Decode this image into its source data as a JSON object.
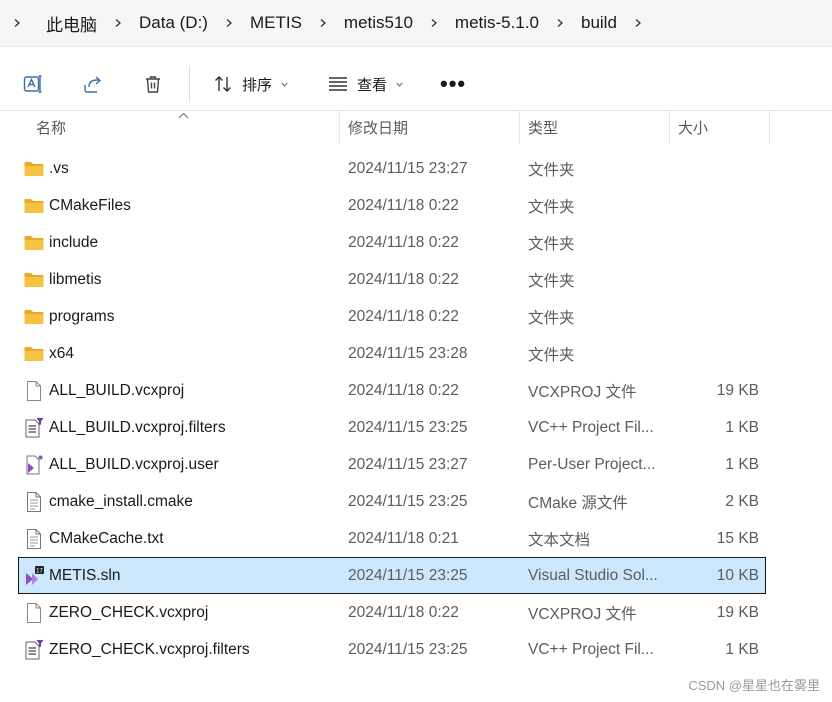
{
  "breadcrumb": {
    "items": [
      "此电脑",
      "Data (D:)",
      "METIS",
      "metis510",
      "metis-5.1.0",
      "build"
    ]
  },
  "toolbar": {
    "rename_icon": "rename-icon",
    "share_icon": "share-icon",
    "delete_icon": "trash-icon",
    "sort_label": "排序",
    "view_label": "查看",
    "more_label": "•••"
  },
  "columns": {
    "name": "名称",
    "modified": "修改日期",
    "type": "类型",
    "size": "大小"
  },
  "files": [
    {
      "name": ".vs",
      "modified": "2024/11/15 23:27",
      "type": "文件夹",
      "size": "",
      "icon": "folder"
    },
    {
      "name": "CMakeFiles",
      "modified": "2024/11/18 0:22",
      "type": "文件夹",
      "size": "",
      "icon": "folder"
    },
    {
      "name": "include",
      "modified": "2024/11/18 0:22",
      "type": "文件夹",
      "size": "",
      "icon": "folder"
    },
    {
      "name": "libmetis",
      "modified": "2024/11/18 0:22",
      "type": "文件夹",
      "size": "",
      "icon": "folder"
    },
    {
      "name": "programs",
      "modified": "2024/11/18 0:22",
      "type": "文件夹",
      "size": "",
      "icon": "folder"
    },
    {
      "name": "x64",
      "modified": "2024/11/15 23:28",
      "type": "文件夹",
      "size": "",
      "icon": "folder"
    },
    {
      "name": "ALL_BUILD.vcxproj",
      "modified": "2024/11/18 0:22",
      "type": "VCXPROJ 文件",
      "size": "19 KB",
      "icon": "file"
    },
    {
      "name": "ALL_BUILD.vcxproj.filters",
      "modified": "2024/11/15 23:25",
      "type": "VC++ Project Fil...",
      "size": "1 KB",
      "icon": "filters"
    },
    {
      "name": "ALL_BUILD.vcxproj.user",
      "modified": "2024/11/15 23:27",
      "type": "Per-User Project...",
      "size": "1 KB",
      "icon": "vs-user"
    },
    {
      "name": "cmake_install.cmake",
      "modified": "2024/11/15 23:25",
      "type": "CMake 源文件",
      "size": "2 KB",
      "icon": "text"
    },
    {
      "name": "CMakeCache.txt",
      "modified": "2024/11/18 0:21",
      "type": "文本文档",
      "size": "15 KB",
      "icon": "text"
    },
    {
      "name": "METIS.sln",
      "modified": "2024/11/15 23:25",
      "type": "Visual Studio Sol...",
      "size": "10 KB",
      "icon": "sln",
      "selected": true
    },
    {
      "name": "ZERO_CHECK.vcxproj",
      "modified": "2024/11/18 0:22",
      "type": "VCXPROJ 文件",
      "size": "19 KB",
      "icon": "file"
    },
    {
      "name": "ZERO_CHECK.vcxproj.filters",
      "modified": "2024/11/15 23:25",
      "type": "VC++ Project Fil...",
      "size": "1 KB",
      "icon": "filters"
    }
  ],
  "watermark": "CSDN @星星也在雾里",
  "colors": {
    "selection": "#cce8ff",
    "folder": "#f6c244",
    "accent": "#0067c0"
  }
}
